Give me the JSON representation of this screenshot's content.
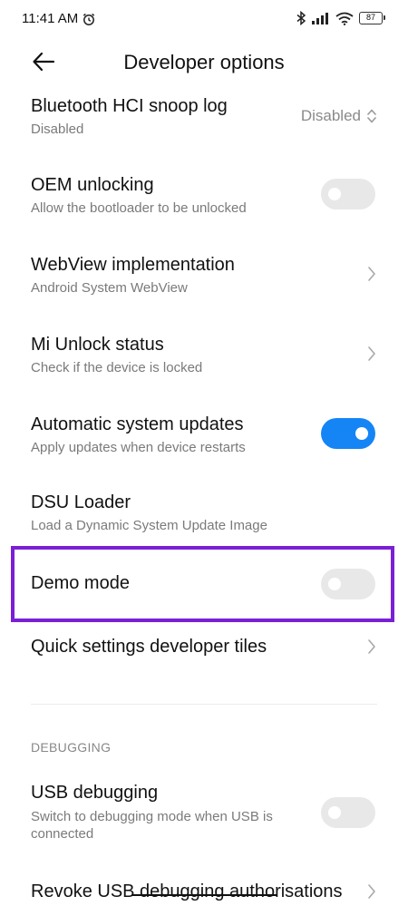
{
  "status_bar": {
    "time": "11:41 AM",
    "alarm_icon": "alarm-clock-icon",
    "battery": "87"
  },
  "header": {
    "title": "Developer options"
  },
  "items": [
    {
      "title": "Bluetooth HCI snoop log",
      "subtitle": "Disabled",
      "control": "select",
      "value": "Disabled"
    },
    {
      "title": "OEM unlocking",
      "subtitle": "Allow the bootloader to be unlocked",
      "control": "toggle",
      "on": false
    },
    {
      "title": "WebView implementation",
      "subtitle": "Android System WebView",
      "control": "chevron"
    },
    {
      "title": "Mi Unlock status",
      "subtitle": "Check if the device is locked",
      "control": "chevron"
    },
    {
      "title": "Automatic system updates",
      "subtitle": "Apply updates when device restarts",
      "control": "toggle",
      "on": true
    },
    {
      "title": "DSU Loader",
      "subtitle": "Load a Dynamic System Update Image",
      "control": "none"
    },
    {
      "title": "Demo mode",
      "control": "toggle",
      "on": false
    },
    {
      "title": "Quick settings developer tiles",
      "control": "chevron"
    }
  ],
  "debugging": {
    "section_label": "DEBUGGING",
    "usb_debugging": {
      "title": "USB debugging",
      "subtitle_line1": "Switch to debugging mode when USB is",
      "subtitle_line2": "connected",
      "on": false
    },
    "revoke": {
      "title": "Revoke USB debugging authorisations"
    }
  },
  "colors": {
    "accent": "#1585f5",
    "highlight": "#7a1fd6"
  }
}
